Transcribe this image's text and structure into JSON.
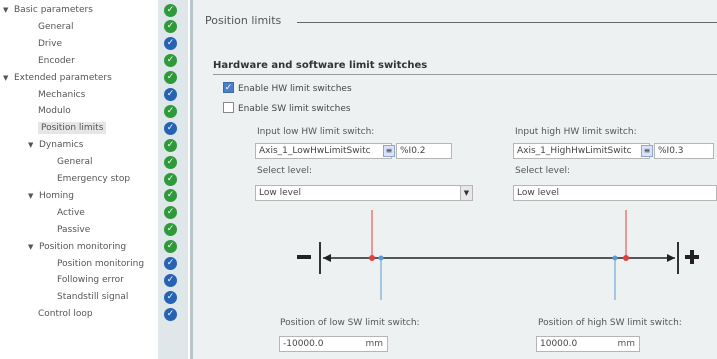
{
  "nav": {
    "items": [
      {
        "label": "Basic parameters",
        "level": 0,
        "expanded": true,
        "status": "green"
      },
      {
        "label": "General",
        "level": 1,
        "status": "green"
      },
      {
        "label": "Drive",
        "level": 1,
        "status": "blue"
      },
      {
        "label": "Encoder",
        "level": 1,
        "status": "green"
      },
      {
        "label": "Extended parameters",
        "level": 0,
        "expanded": true,
        "status": "green"
      },
      {
        "label": "Mechanics",
        "level": 1,
        "status": "blue"
      },
      {
        "label": "Modulo",
        "level": 1,
        "status": "green"
      },
      {
        "label": "Position limits",
        "level": 1,
        "status": "blue",
        "selected": true
      },
      {
        "label": "Dynamics",
        "level": 1,
        "expanded": true,
        "status": "green"
      },
      {
        "label": "General",
        "level": 2,
        "status": "green"
      },
      {
        "label": "Emergency stop",
        "level": 2,
        "status": "green"
      },
      {
        "label": "Homing",
        "level": 1,
        "expanded": true,
        "status": "green"
      },
      {
        "label": "Active",
        "level": 2,
        "status": "green"
      },
      {
        "label": "Passive",
        "level": 2,
        "status": "green"
      },
      {
        "label": "Position monitoring",
        "level": 1,
        "expanded": true,
        "status": "green"
      },
      {
        "label": "Position monitoring",
        "level": 2,
        "status": "blue"
      },
      {
        "label": "Following error",
        "level": 2,
        "status": "blue"
      },
      {
        "label": "Standstill signal",
        "level": 2,
        "status": "blue"
      },
      {
        "label": "Control loop",
        "level": 1,
        "status": "blue"
      }
    ]
  },
  "panel": {
    "title": "Position limits",
    "section_title": "Hardware and software limit switches",
    "enable_hw": {
      "label": "Enable HW limit switches",
      "checked": true
    },
    "enable_sw": {
      "label": "Enable SW limit switches",
      "checked": false
    },
    "low_hw": {
      "label": "Input low HW limit switch:",
      "tag": "Axis_1_LowHwLimitSwitc",
      "address": "%I0.2",
      "level_label": "Select level:",
      "level_value": "Low level"
    },
    "high_hw": {
      "label": "Input high HW limit switch:",
      "tag": "Axis_1_HighHwLimitSwitc",
      "address": "%I0.3",
      "level_label": "Select level:",
      "level_value": "Low level"
    },
    "low_sw": {
      "label": "Position of low SW limit switch:",
      "value": "-10000.0",
      "unit": "mm"
    },
    "high_sw": {
      "label": "Position of high SW limit switch:",
      "value": "10000.0",
      "unit": "mm"
    }
  },
  "colors": {
    "check_green": "#2e9a3a",
    "check_blue": "#2663b5",
    "hw_marker": "#e04040",
    "sw_marker": "#5b9bd5",
    "sidebar_status_bg": "#dfe7ea",
    "panel_bg": "#eef1f2"
  },
  "icons": {
    "status_ok": "check-circle-icon",
    "expand": "triangle-down-icon",
    "browse": "browse-icon",
    "dropdown": "chevron-down-icon",
    "minus": "minus-icon",
    "plus": "plus-icon"
  }
}
